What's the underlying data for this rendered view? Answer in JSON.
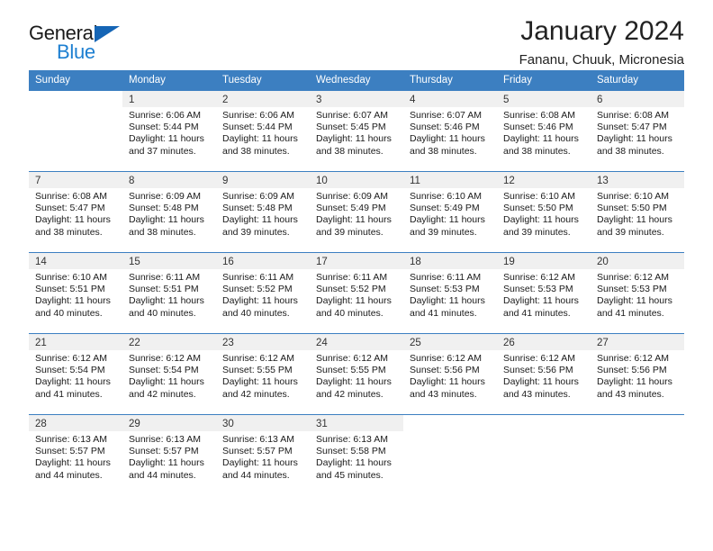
{
  "brand": {
    "name_top": "General",
    "name_bottom": "Blue",
    "triangle_color": "#1565b5",
    "blue_color": "#1d7fd1"
  },
  "header": {
    "title": "January 2024",
    "subtitle": "Fananu, Chuuk, Micronesia"
  },
  "theme": {
    "header_blue": "#3c7fc1",
    "daynum_band": "#f0f0f0"
  },
  "weekday_headers": [
    "Sunday",
    "Monday",
    "Tuesday",
    "Wednesday",
    "Thursday",
    "Friday",
    "Saturday"
  ],
  "weeks": [
    [
      {
        "day": "",
        "sunrise": "",
        "sunset": "",
        "daylight_line1": "",
        "daylight_line2": ""
      },
      {
        "day": "1",
        "sunrise": "Sunrise: 6:06 AM",
        "sunset": "Sunset: 5:44 PM",
        "daylight_line1": "Daylight: 11 hours",
        "daylight_line2": "and 37 minutes."
      },
      {
        "day": "2",
        "sunrise": "Sunrise: 6:06 AM",
        "sunset": "Sunset: 5:44 PM",
        "daylight_line1": "Daylight: 11 hours",
        "daylight_line2": "and 38 minutes."
      },
      {
        "day": "3",
        "sunrise": "Sunrise: 6:07 AM",
        "sunset": "Sunset: 5:45 PM",
        "daylight_line1": "Daylight: 11 hours",
        "daylight_line2": "and 38 minutes."
      },
      {
        "day": "4",
        "sunrise": "Sunrise: 6:07 AM",
        "sunset": "Sunset: 5:46 PM",
        "daylight_line1": "Daylight: 11 hours",
        "daylight_line2": "and 38 minutes."
      },
      {
        "day": "5",
        "sunrise": "Sunrise: 6:08 AM",
        "sunset": "Sunset: 5:46 PM",
        "daylight_line1": "Daylight: 11 hours",
        "daylight_line2": "and 38 minutes."
      },
      {
        "day": "6",
        "sunrise": "Sunrise: 6:08 AM",
        "sunset": "Sunset: 5:47 PM",
        "daylight_line1": "Daylight: 11 hours",
        "daylight_line2": "and 38 minutes."
      }
    ],
    [
      {
        "day": "7",
        "sunrise": "Sunrise: 6:08 AM",
        "sunset": "Sunset: 5:47 PM",
        "daylight_line1": "Daylight: 11 hours",
        "daylight_line2": "and 38 minutes."
      },
      {
        "day": "8",
        "sunrise": "Sunrise: 6:09 AM",
        "sunset": "Sunset: 5:48 PM",
        "daylight_line1": "Daylight: 11 hours",
        "daylight_line2": "and 38 minutes."
      },
      {
        "day": "9",
        "sunrise": "Sunrise: 6:09 AM",
        "sunset": "Sunset: 5:48 PM",
        "daylight_line1": "Daylight: 11 hours",
        "daylight_line2": "and 39 minutes."
      },
      {
        "day": "10",
        "sunrise": "Sunrise: 6:09 AM",
        "sunset": "Sunset: 5:49 PM",
        "daylight_line1": "Daylight: 11 hours",
        "daylight_line2": "and 39 minutes."
      },
      {
        "day": "11",
        "sunrise": "Sunrise: 6:10 AM",
        "sunset": "Sunset: 5:49 PM",
        "daylight_line1": "Daylight: 11 hours",
        "daylight_line2": "and 39 minutes."
      },
      {
        "day": "12",
        "sunrise": "Sunrise: 6:10 AM",
        "sunset": "Sunset: 5:50 PM",
        "daylight_line1": "Daylight: 11 hours",
        "daylight_line2": "and 39 minutes."
      },
      {
        "day": "13",
        "sunrise": "Sunrise: 6:10 AM",
        "sunset": "Sunset: 5:50 PM",
        "daylight_line1": "Daylight: 11 hours",
        "daylight_line2": "and 39 minutes."
      }
    ],
    [
      {
        "day": "14",
        "sunrise": "Sunrise: 6:10 AM",
        "sunset": "Sunset: 5:51 PM",
        "daylight_line1": "Daylight: 11 hours",
        "daylight_line2": "and 40 minutes."
      },
      {
        "day": "15",
        "sunrise": "Sunrise: 6:11 AM",
        "sunset": "Sunset: 5:51 PM",
        "daylight_line1": "Daylight: 11 hours",
        "daylight_line2": "and 40 minutes."
      },
      {
        "day": "16",
        "sunrise": "Sunrise: 6:11 AM",
        "sunset": "Sunset: 5:52 PM",
        "daylight_line1": "Daylight: 11 hours",
        "daylight_line2": "and 40 minutes."
      },
      {
        "day": "17",
        "sunrise": "Sunrise: 6:11 AM",
        "sunset": "Sunset: 5:52 PM",
        "daylight_line1": "Daylight: 11 hours",
        "daylight_line2": "and 40 minutes."
      },
      {
        "day": "18",
        "sunrise": "Sunrise: 6:11 AM",
        "sunset": "Sunset: 5:53 PM",
        "daylight_line1": "Daylight: 11 hours",
        "daylight_line2": "and 41 minutes."
      },
      {
        "day": "19",
        "sunrise": "Sunrise: 6:12 AM",
        "sunset": "Sunset: 5:53 PM",
        "daylight_line1": "Daylight: 11 hours",
        "daylight_line2": "and 41 minutes."
      },
      {
        "day": "20",
        "sunrise": "Sunrise: 6:12 AM",
        "sunset": "Sunset: 5:53 PM",
        "daylight_line1": "Daylight: 11 hours",
        "daylight_line2": "and 41 minutes."
      }
    ],
    [
      {
        "day": "21",
        "sunrise": "Sunrise: 6:12 AM",
        "sunset": "Sunset: 5:54 PM",
        "daylight_line1": "Daylight: 11 hours",
        "daylight_line2": "and 41 minutes."
      },
      {
        "day": "22",
        "sunrise": "Sunrise: 6:12 AM",
        "sunset": "Sunset: 5:54 PM",
        "daylight_line1": "Daylight: 11 hours",
        "daylight_line2": "and 42 minutes."
      },
      {
        "day": "23",
        "sunrise": "Sunrise: 6:12 AM",
        "sunset": "Sunset: 5:55 PM",
        "daylight_line1": "Daylight: 11 hours",
        "daylight_line2": "and 42 minutes."
      },
      {
        "day": "24",
        "sunrise": "Sunrise: 6:12 AM",
        "sunset": "Sunset: 5:55 PM",
        "daylight_line1": "Daylight: 11 hours",
        "daylight_line2": "and 42 minutes."
      },
      {
        "day": "25",
        "sunrise": "Sunrise: 6:12 AM",
        "sunset": "Sunset: 5:56 PM",
        "daylight_line1": "Daylight: 11 hours",
        "daylight_line2": "and 43 minutes."
      },
      {
        "day": "26",
        "sunrise": "Sunrise: 6:12 AM",
        "sunset": "Sunset: 5:56 PM",
        "daylight_line1": "Daylight: 11 hours",
        "daylight_line2": "and 43 minutes."
      },
      {
        "day": "27",
        "sunrise": "Sunrise: 6:12 AM",
        "sunset": "Sunset: 5:56 PM",
        "daylight_line1": "Daylight: 11 hours",
        "daylight_line2": "and 43 minutes."
      }
    ],
    [
      {
        "day": "28",
        "sunrise": "Sunrise: 6:13 AM",
        "sunset": "Sunset: 5:57 PM",
        "daylight_line1": "Daylight: 11 hours",
        "daylight_line2": "and 44 minutes."
      },
      {
        "day": "29",
        "sunrise": "Sunrise: 6:13 AM",
        "sunset": "Sunset: 5:57 PM",
        "daylight_line1": "Daylight: 11 hours",
        "daylight_line2": "and 44 minutes."
      },
      {
        "day": "30",
        "sunrise": "Sunrise: 6:13 AM",
        "sunset": "Sunset: 5:57 PM",
        "daylight_line1": "Daylight: 11 hours",
        "daylight_line2": "and 44 minutes."
      },
      {
        "day": "31",
        "sunrise": "Sunrise: 6:13 AM",
        "sunset": "Sunset: 5:58 PM",
        "daylight_line1": "Daylight: 11 hours",
        "daylight_line2": "and 45 minutes."
      },
      {
        "day": "",
        "sunrise": "",
        "sunset": "",
        "daylight_line1": "",
        "daylight_line2": ""
      },
      {
        "day": "",
        "sunrise": "",
        "sunset": "",
        "daylight_line1": "",
        "daylight_line2": ""
      },
      {
        "day": "",
        "sunrise": "",
        "sunset": "",
        "daylight_line1": "",
        "daylight_line2": ""
      }
    ]
  ]
}
